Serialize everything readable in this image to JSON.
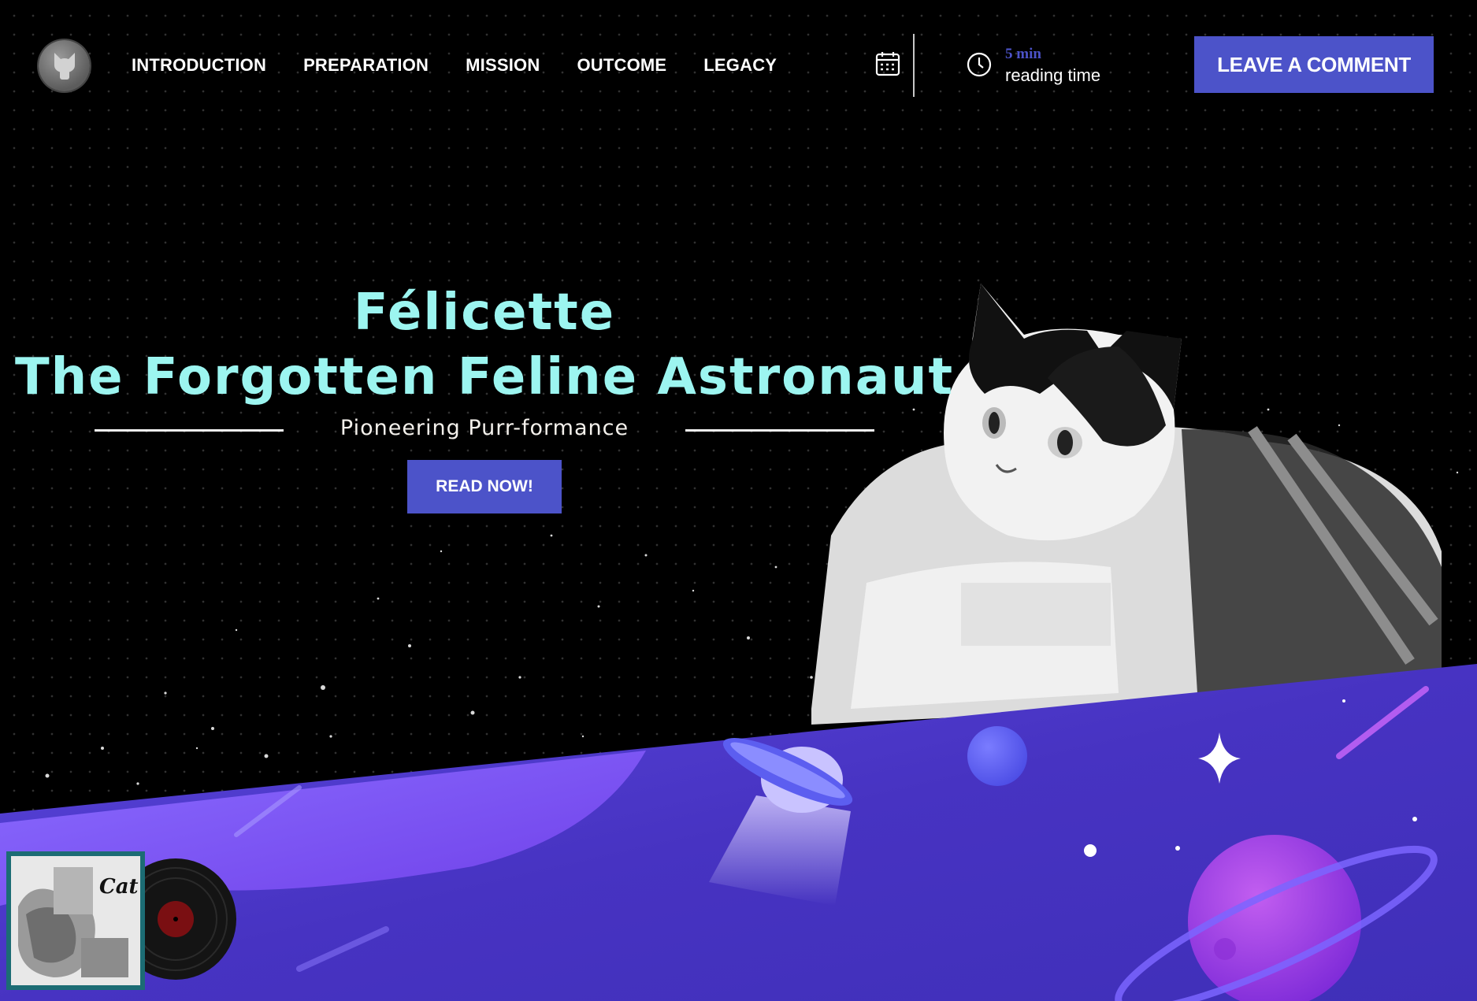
{
  "nav": {
    "menu": [
      "INTRODUCTION",
      "PREPARATION",
      "MISSION",
      "OUTCOME",
      "LEGACY"
    ],
    "reading_minutes": "5 min",
    "reading_label": "reading time",
    "comment_button": "LEAVE A COMMENT",
    "icons": [
      "cat-logo-icon",
      "calendar-icon",
      "clock-icon"
    ]
  },
  "hero": {
    "title_line1": "Félicette",
    "title_line2": "The Forgotten Feline Astronaut",
    "subtitle": "Pioneering Purr-formance",
    "cta": "READ NOW!"
  },
  "album": {
    "cover_text": "Cat"
  },
  "colors": {
    "accent": "#4c53c9",
    "title": "#9cf5f0",
    "planet_band": "#4b3bd0"
  }
}
